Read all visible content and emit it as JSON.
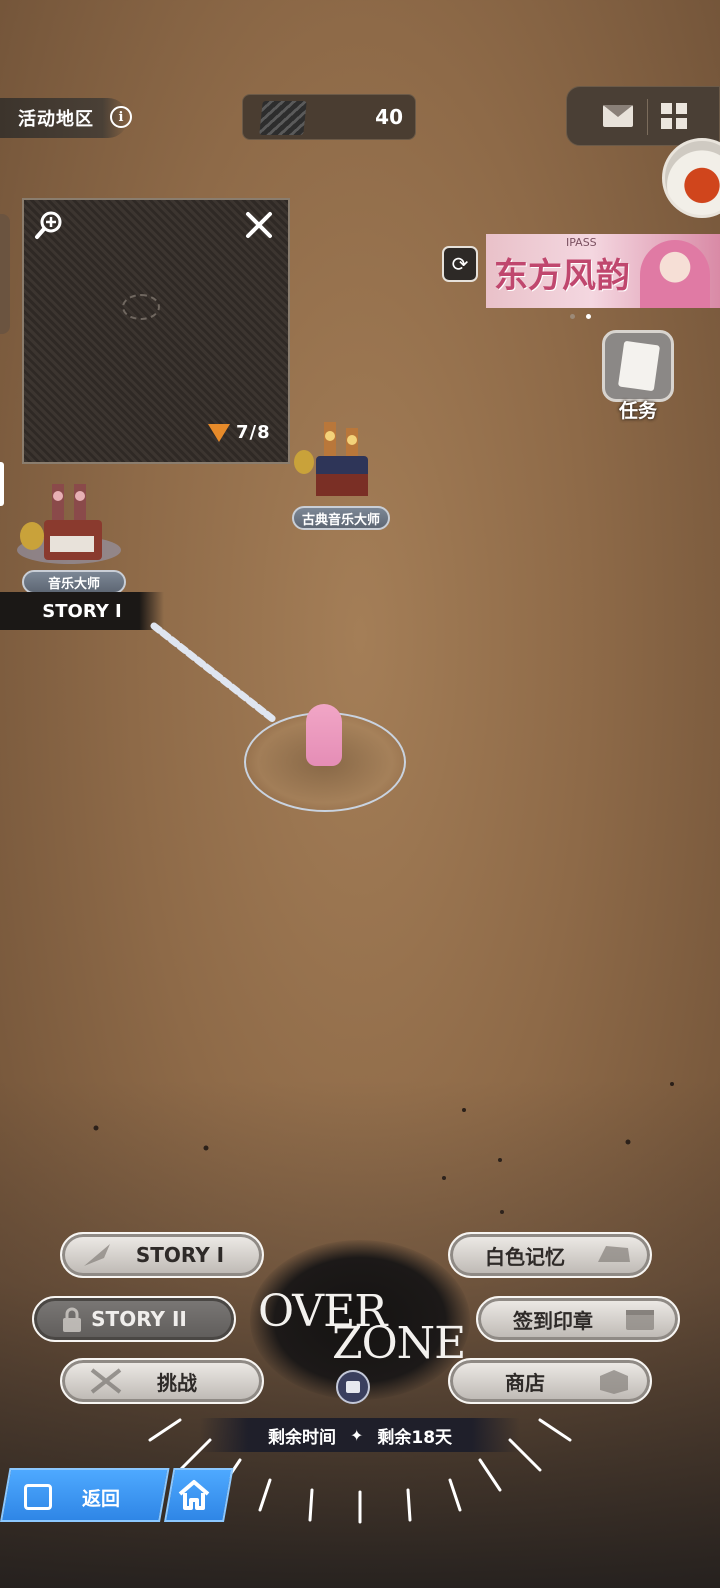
{
  "top_bar": {
    "region_label": "活动地区",
    "info_icon": "i",
    "currency_value": "40",
    "icons": [
      "info-icon",
      "film-ticket-icon",
      "mail-icon",
      "grid-menu-icon"
    ]
  },
  "minimap": {
    "progress": "7/8",
    "icons": [
      "zoom-in-icon",
      "close-icon",
      "key-icon"
    ]
  },
  "banner": {
    "title": "东方风韵",
    "pass_tag": "IPASS"
  },
  "quest": {
    "label": "任务"
  },
  "map_nodes": {
    "classical_label": "古典音乐大师",
    "music_label": "音乐大师",
    "story_one_tag": "STORY I"
  },
  "menu": {
    "story_one": "STORY I",
    "story_two": "STORY II",
    "challenge": "挑战",
    "white_memory": "白色记忆",
    "checkin_stamp": "签到印章",
    "shop": "商店"
  },
  "logo": {
    "over": "OVER",
    "zone": "ZONE"
  },
  "time": {
    "remaining_label": "剩余时间",
    "remaining_value": "剩余18天"
  },
  "nav": {
    "back_label": "返回"
  },
  "colors": {
    "background": "#8e6a48",
    "nav_blue": "#2f86e6",
    "progress_orange": "#e68a2a",
    "banner_pink": "#c0476e"
  }
}
